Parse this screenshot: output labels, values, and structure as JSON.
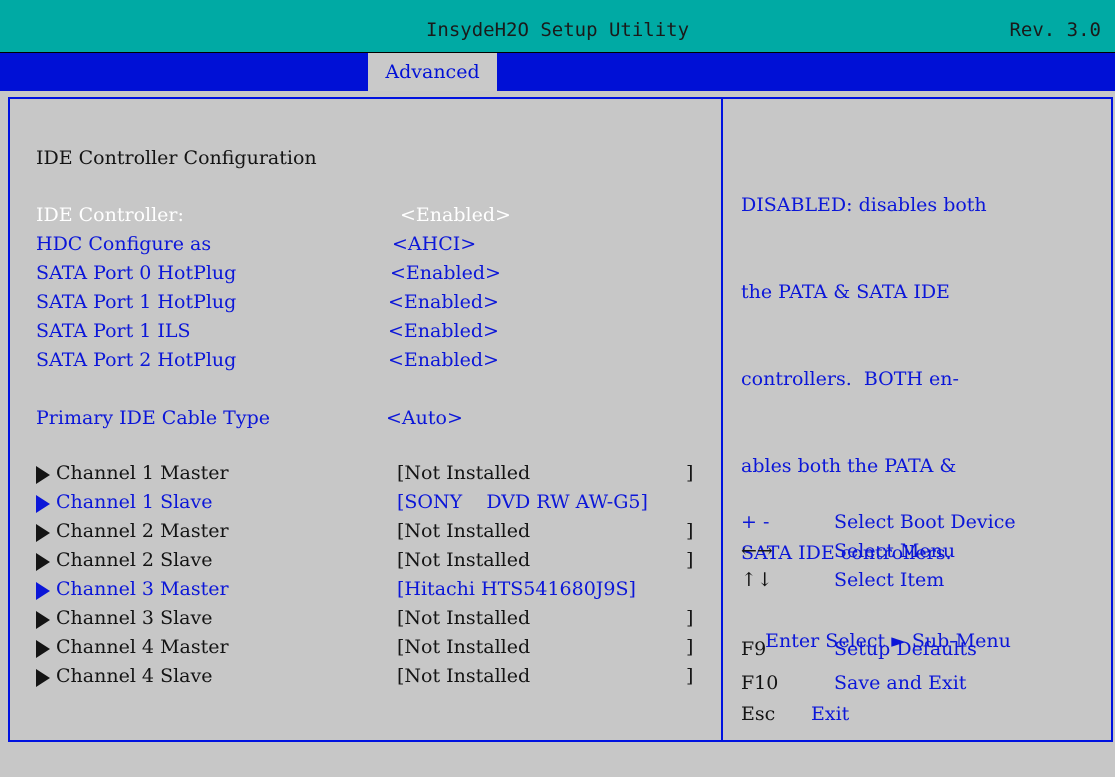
{
  "header": {
    "title": "InsydeH2O Setup Utility",
    "revision": "Rev. 3.0"
  },
  "menu": {
    "active_tab": "Advanced"
  },
  "section": {
    "title": "IDE Controller Configuration"
  },
  "settings": [
    {
      "label": "IDE Controller:",
      "value": "<Enabled>"
    },
    {
      "label": "HDC Configure as",
      "value": "<AHCI>"
    },
    {
      "label": "SATA Port 0 HotPlug",
      "value": "<Enabled>"
    },
    {
      "label": "SATA Port 1 HotPlug",
      "value": "<Enabled>"
    },
    {
      "label": "SATA Port 1 ILS",
      "value": "<Enabled>"
    },
    {
      "label": "SATA Port 2 HotPlug",
      "value": "<Enabled>"
    },
    {
      "label": "Primary IDE Cable Type",
      "value": "<Auto>"
    }
  ],
  "channels": [
    {
      "label": "Channel 1 Master",
      "value": "[Not Installed",
      "close": "]"
    },
    {
      "label": "Channel 1 Slave",
      "value": "[SONY    DVD RW AW-G5]",
      "close": ""
    },
    {
      "label": "Channel 2 Master",
      "value": "[Not Installed",
      "close": "]"
    },
    {
      "label": "Channel 2 Slave",
      "value": "[Not Installed",
      "close": "]"
    },
    {
      "label": "Channel 3 Master",
      "value": "[Hitachi HTS541680J9S]",
      "close": ""
    },
    {
      "label": "Channel 3 Slave",
      "value": "[Not Installed",
      "close": "]"
    },
    {
      "label": "Channel 4 Master",
      "value": "[Not Installed",
      "close": "]"
    },
    {
      "label": "Channel 4 Slave",
      "value": "[Not Installed",
      "close": "]"
    }
  ],
  "help": {
    "lines": [
      "DISABLED: disables both",
      "the PATA & SATA IDE",
      "controllers.  BOTH en-",
      "ables both the PATA &",
      "SATA IDE controllers."
    ]
  },
  "keys": [
    {
      "key": "+ -",
      "desc": "Select Boot Device"
    },
    {
      "key": "←→",
      "desc": "Select Menu"
    },
    {
      "key": "↑↓",
      "desc": "Select Item"
    },
    {
      "key": "Enter",
      "desc": "Select ► Sub-Menu"
    },
    {
      "key": "F9",
      "desc": "Setup Defaults"
    },
    {
      "key": "F10",
      "desc": "Save and Exit"
    },
    {
      "key": "Esc",
      "desc": "Exit"
    }
  ],
  "colors": {
    "title_bar": "#00aaa4",
    "menu_bar": "#0010d6",
    "background": "#c7c7c7",
    "accent_blue": "#0b16d8",
    "selected_text": "#ffffff"
  }
}
